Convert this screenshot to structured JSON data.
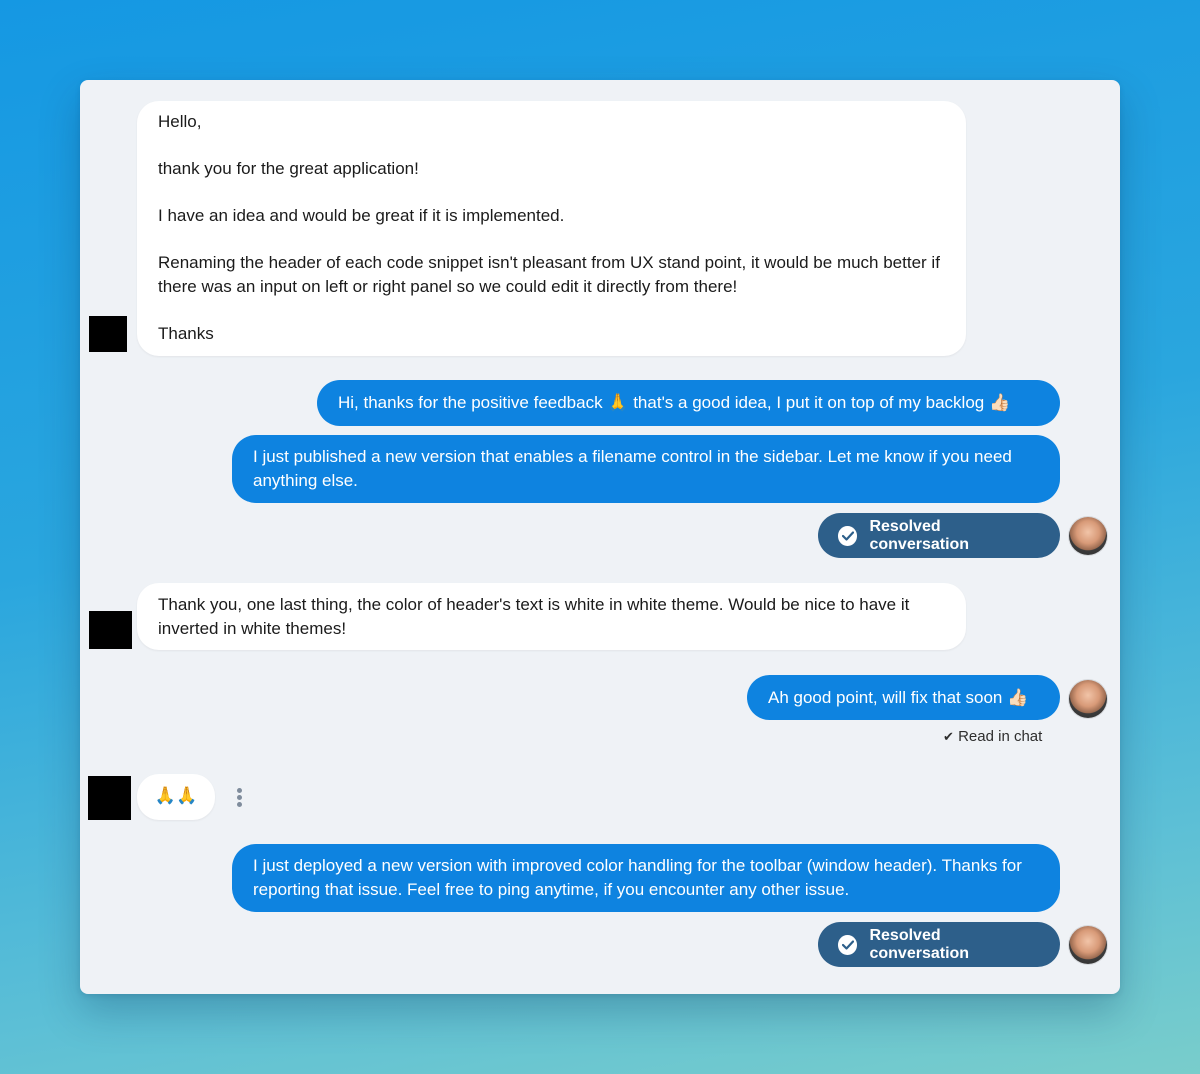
{
  "messages": [
    {
      "side": "customer",
      "paragraphs": [
        "Hello,",
        "thank you for the great application!",
        "I have an idea and would be great if it is implemented.",
        "Renaming the header of each code snippet isn't pleasant from UX stand point, it would be much better if there was an input on left or right panel so we could edit it directly from there!",
        "Thanks"
      ]
    },
    {
      "side": "agent",
      "text_before": "Hi, thanks for the positive feedback ",
      "emoji_1": "🙏",
      "text_middle": " that's a good idea, I put it on top of my backlog ",
      "emoji_2": "👍🏻"
    },
    {
      "side": "agent",
      "text": "I just published a new version that enables a filename control in the sidebar. Let me know if you need anything else."
    },
    {
      "side": "customer",
      "text": "Thank you, one last thing, the color of header's text is white in white theme. Would be nice to have it inverted in white themes!"
    },
    {
      "side": "agent",
      "text": "Ah good point, will fix that soon ",
      "emoji": "👍🏻"
    },
    {
      "side": "customer",
      "text": "🙏🙏"
    },
    {
      "side": "agent",
      "text": "I just deployed a new version with improved color handling for the toolbar (window header). Thanks for reporting that issue. Feel free to ping anytime, if you encounter any other issue."
    }
  ],
  "status": {
    "resolved_label": "Resolved conversation",
    "read_label": "Read in chat",
    "read_check": "✔"
  },
  "colors": {
    "agent_bubble": "#0e83e0",
    "customer_bubble": "#ffffff",
    "resolved_pill": "#2d5f8a",
    "window_bg": "#eff2f6"
  },
  "icons": {
    "resolved": "check-circle-icon",
    "menu": "more-vertical-icon"
  }
}
